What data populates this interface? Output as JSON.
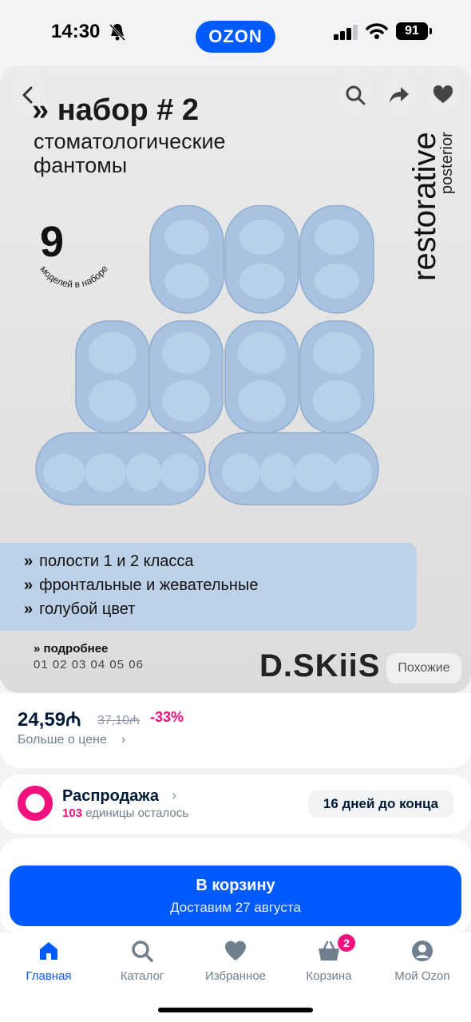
{
  "status_bar": {
    "time": "14:30",
    "battery": "91"
  },
  "header": {
    "brand": "OZON"
  },
  "hero": {
    "headline": "» набор # 2",
    "subtitle_line1": "стоматологические",
    "subtitle_line2": "фантомы",
    "count": "9",
    "count_caption": "моделей в наборе",
    "vertical_title": "restorative",
    "vertical_subtitle": "posterior",
    "features": [
      "полости 1 и 2 класса",
      "фронтальные и жевательные",
      "голубой цвет"
    ],
    "more_label": "подробнее",
    "numbers": "01 02 03 04 05 06",
    "logo": "D.SKiiS",
    "similar_label": "Похожие",
    "colors": {
      "tooth": "#a8c2e0",
      "features_bg": "#bcd0e8"
    }
  },
  "price": {
    "current": "24,59",
    "currency": "₼",
    "old": "37,10",
    "discount": "-33%",
    "more_label": "Больше о цене"
  },
  "sale": {
    "title": "Распродажа",
    "count": "103",
    "remaining_text": "единицы осталось",
    "badge": "16 дней до конца"
  },
  "cart_button": {
    "label": "В корзину",
    "delivery": "Доставим 27 августа"
  },
  "tabs": [
    {
      "label": "Главная",
      "icon": "home-icon",
      "active": true
    },
    {
      "label": "Каталог",
      "icon": "search-icon"
    },
    {
      "label": "Избранное",
      "icon": "heart-icon"
    },
    {
      "label": "Корзина",
      "icon": "basket-icon",
      "badge": "2"
    },
    {
      "label": "Мой Ozon",
      "icon": "user-icon"
    }
  ],
  "colors": {
    "accent": "#005bff",
    "pink": "#f1117e"
  }
}
